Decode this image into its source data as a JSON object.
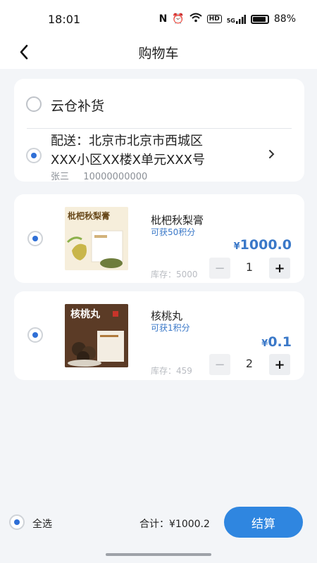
{
  "status": {
    "time": "18:01",
    "nfc": "N",
    "hd": "HD",
    "signal": "5G",
    "battery": "88%"
  },
  "nav": {
    "title": "购物车"
  },
  "delivery": {
    "cloud_option": "云仓补货",
    "address_line1": "配送：北京市北京市西城区",
    "address_line2": "XXX小区XX楼X单元XXX号",
    "contact_name": "张三",
    "contact_phone": "10000000000"
  },
  "products": [
    {
      "name": "枇杷秋梨膏",
      "points": "可获50积分",
      "price_symbol": "¥",
      "price": "1000.0",
      "stock": "库存：5000",
      "quantity": "1",
      "minus": "−",
      "plus": "+",
      "img_title": "枇杷秋梨膏"
    },
    {
      "name": "核桃丸",
      "points": "可获1积分",
      "price_symbol": "¥",
      "price": "0.1",
      "stock": "库存：459",
      "quantity": "2",
      "minus": "−",
      "plus": "+",
      "img_title": "核桃丸"
    }
  ],
  "footer": {
    "select_all": "全选",
    "total": "合计：¥1000.2",
    "checkout": "结算"
  },
  "colors": {
    "accent": "#2f86e0",
    "price": "#3a78c8",
    "background": "#f3f5f8"
  }
}
